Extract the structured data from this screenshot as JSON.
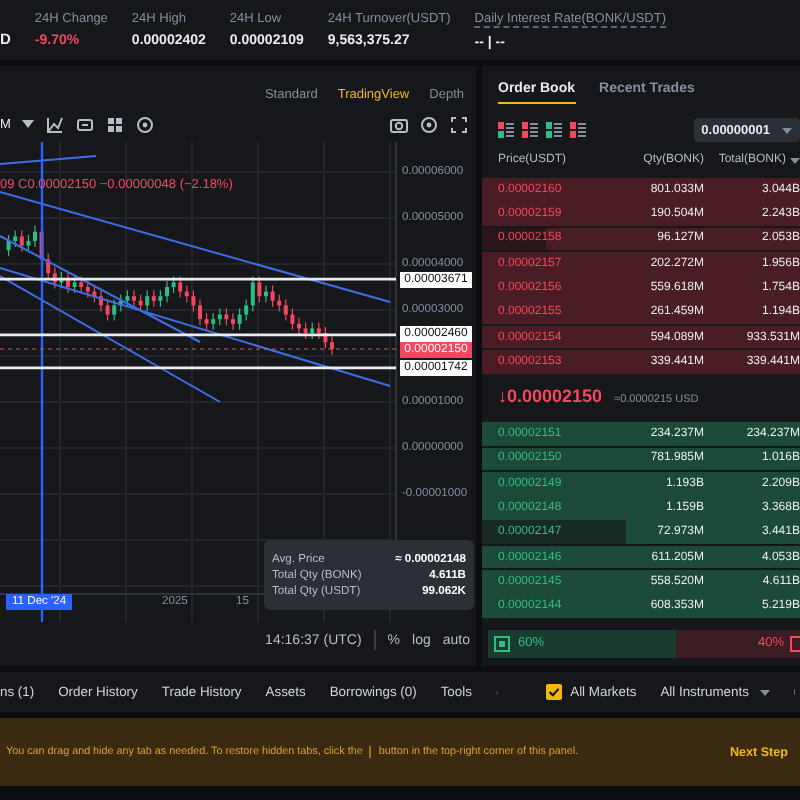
{
  "ticker": {
    "symbol_fragment": "D",
    "stats": [
      {
        "label": "24H Change",
        "value": "-9.70%",
        "kind": "down"
      },
      {
        "label": "24H High",
        "value": "0.00002402",
        "kind": "plain"
      },
      {
        "label": "24H Low",
        "value": "0.00002109",
        "kind": "plain"
      },
      {
        "label": "24H Turnover(USDT)",
        "value": "9,563,375.27",
        "kind": "plain"
      },
      {
        "label": "Daily Interest Rate(BONK/USDT)",
        "value": "-- | --",
        "kind": "plain"
      }
    ]
  },
  "chart": {
    "views": [
      {
        "label": "Standard",
        "selected": false
      },
      {
        "label": "TradingView",
        "selected": true
      },
      {
        "label": "Depth",
        "selected": false
      }
    ],
    "interval": "M",
    "legend": "09 C0.00002150 −0.00000048 (−2.18%)",
    "price_ticks": [
      "0.00006000",
      "0.00005000",
      "0.00004000",
      "0.00003000",
      "0.00001000",
      "0.00000000",
      "-0.00001000"
    ],
    "price_markers": [
      {
        "value": "0.00003671",
        "kind": "line"
      },
      {
        "value": "0.00002460",
        "kind": "line"
      },
      {
        "value": "0.00002150",
        "kind": "last"
      },
      {
        "value": "0.00001742",
        "kind": "line"
      }
    ],
    "time_labels": [
      {
        "label": "11 Dec '24",
        "selected": true
      },
      {
        "label": "2025",
        "selected": false
      },
      {
        "label": "15",
        "selected": false
      }
    ],
    "tooltip": [
      {
        "label": "Avg. Price",
        "value": "≈ 0.00002148"
      },
      {
        "label": "Total Qty (BONK)",
        "value": "4.611B"
      },
      {
        "label": "Total Qty (USDT)",
        "value": "99.062K"
      }
    ],
    "time": "14:16:37 (UTC)",
    "scale_options": [
      "%",
      "log",
      "auto"
    ]
  },
  "order_book": {
    "tabs": [
      {
        "label": "Order Book",
        "selected": true
      },
      {
        "label": "Recent Trades",
        "selected": false
      }
    ],
    "precision": "0.00000001",
    "columns": [
      "Price(USDT)",
      "Qty(BONK)",
      "Total(BONK)"
    ],
    "asks": [
      {
        "price": "0.00002160",
        "qty": "801.033M",
        "total": "3.044B",
        "level": 1
      },
      {
        "price": "0.00002159",
        "qty": "190.504M",
        "total": "2.243B",
        "level": 1
      },
      {
        "price": "0.00002158",
        "qty": "96.127M",
        "total": "2.053B",
        "level": 0.8
      },
      {
        "price": "0.00002157",
        "qty": "202.272M",
        "total": "1.956B",
        "level": 1
      },
      {
        "price": "0.00002156",
        "qty": "559.618M",
        "total": "1.754B",
        "level": 1
      },
      {
        "price": "0.00002155",
        "qty": "261.459M",
        "total": "1.194B",
        "level": 1
      },
      {
        "price": "0.00002154",
        "qty": "594.089M",
        "total": "933.531M",
        "level": 1
      },
      {
        "price": "0.00002153",
        "qty": "339.441M",
        "total": "339.441M",
        "level": 1
      }
    ],
    "last_price": {
      "arrow": "↓",
      "value": "0.00002150",
      "usd": "≈0.0000215 USD"
    },
    "bids": [
      {
        "price": "0.00002151",
        "qty": "234.237M",
        "total": "234.237M",
        "level": 1
      },
      {
        "price": "0.00002150",
        "qty": "781.985M",
        "total": "1.016B",
        "level": 1
      },
      {
        "price": "0.00002149",
        "qty": "1.193B",
        "total": "2.209B",
        "level": 1
      },
      {
        "price": "0.00002148",
        "qty": "1.159B",
        "total": "3.368B",
        "level": 1
      },
      {
        "price": "0.00002147",
        "qty": "72.973M",
        "total": "3.441B",
        "level": 0.55
      },
      {
        "price": "0.00002146",
        "qty": "611.205M",
        "total": "4.053B",
        "level": 1
      },
      {
        "price": "0.00002145",
        "qty": "558.520M",
        "total": "4.611B",
        "level": 1
      },
      {
        "price": "0.00002144",
        "qty": "608.353M",
        "total": "5.219B",
        "level": 1
      }
    ],
    "ratio": {
      "buy": "60%",
      "sell": "40%",
      "level": 0.6
    }
  },
  "bottom_tabs": [
    {
      "label": "ns (1)",
      "selected": false
    },
    {
      "label": "Order History",
      "selected": false
    },
    {
      "label": "Trade History",
      "selected": false
    },
    {
      "label": "Assets",
      "selected": false
    },
    {
      "label": "Borrowings (0)",
      "selected": false
    },
    {
      "label": "Tools",
      "selected": false
    }
  ],
  "filter": {
    "label": "All Markets",
    "checked": true
  },
  "instruments": "All Instruments",
  "banner": {
    "text_before": "You can drag and hide any tab as needed. To restore hidden tabs, click the",
    "text_after": "button in the top-right corner of this panel.",
    "action": "Next Step"
  }
}
